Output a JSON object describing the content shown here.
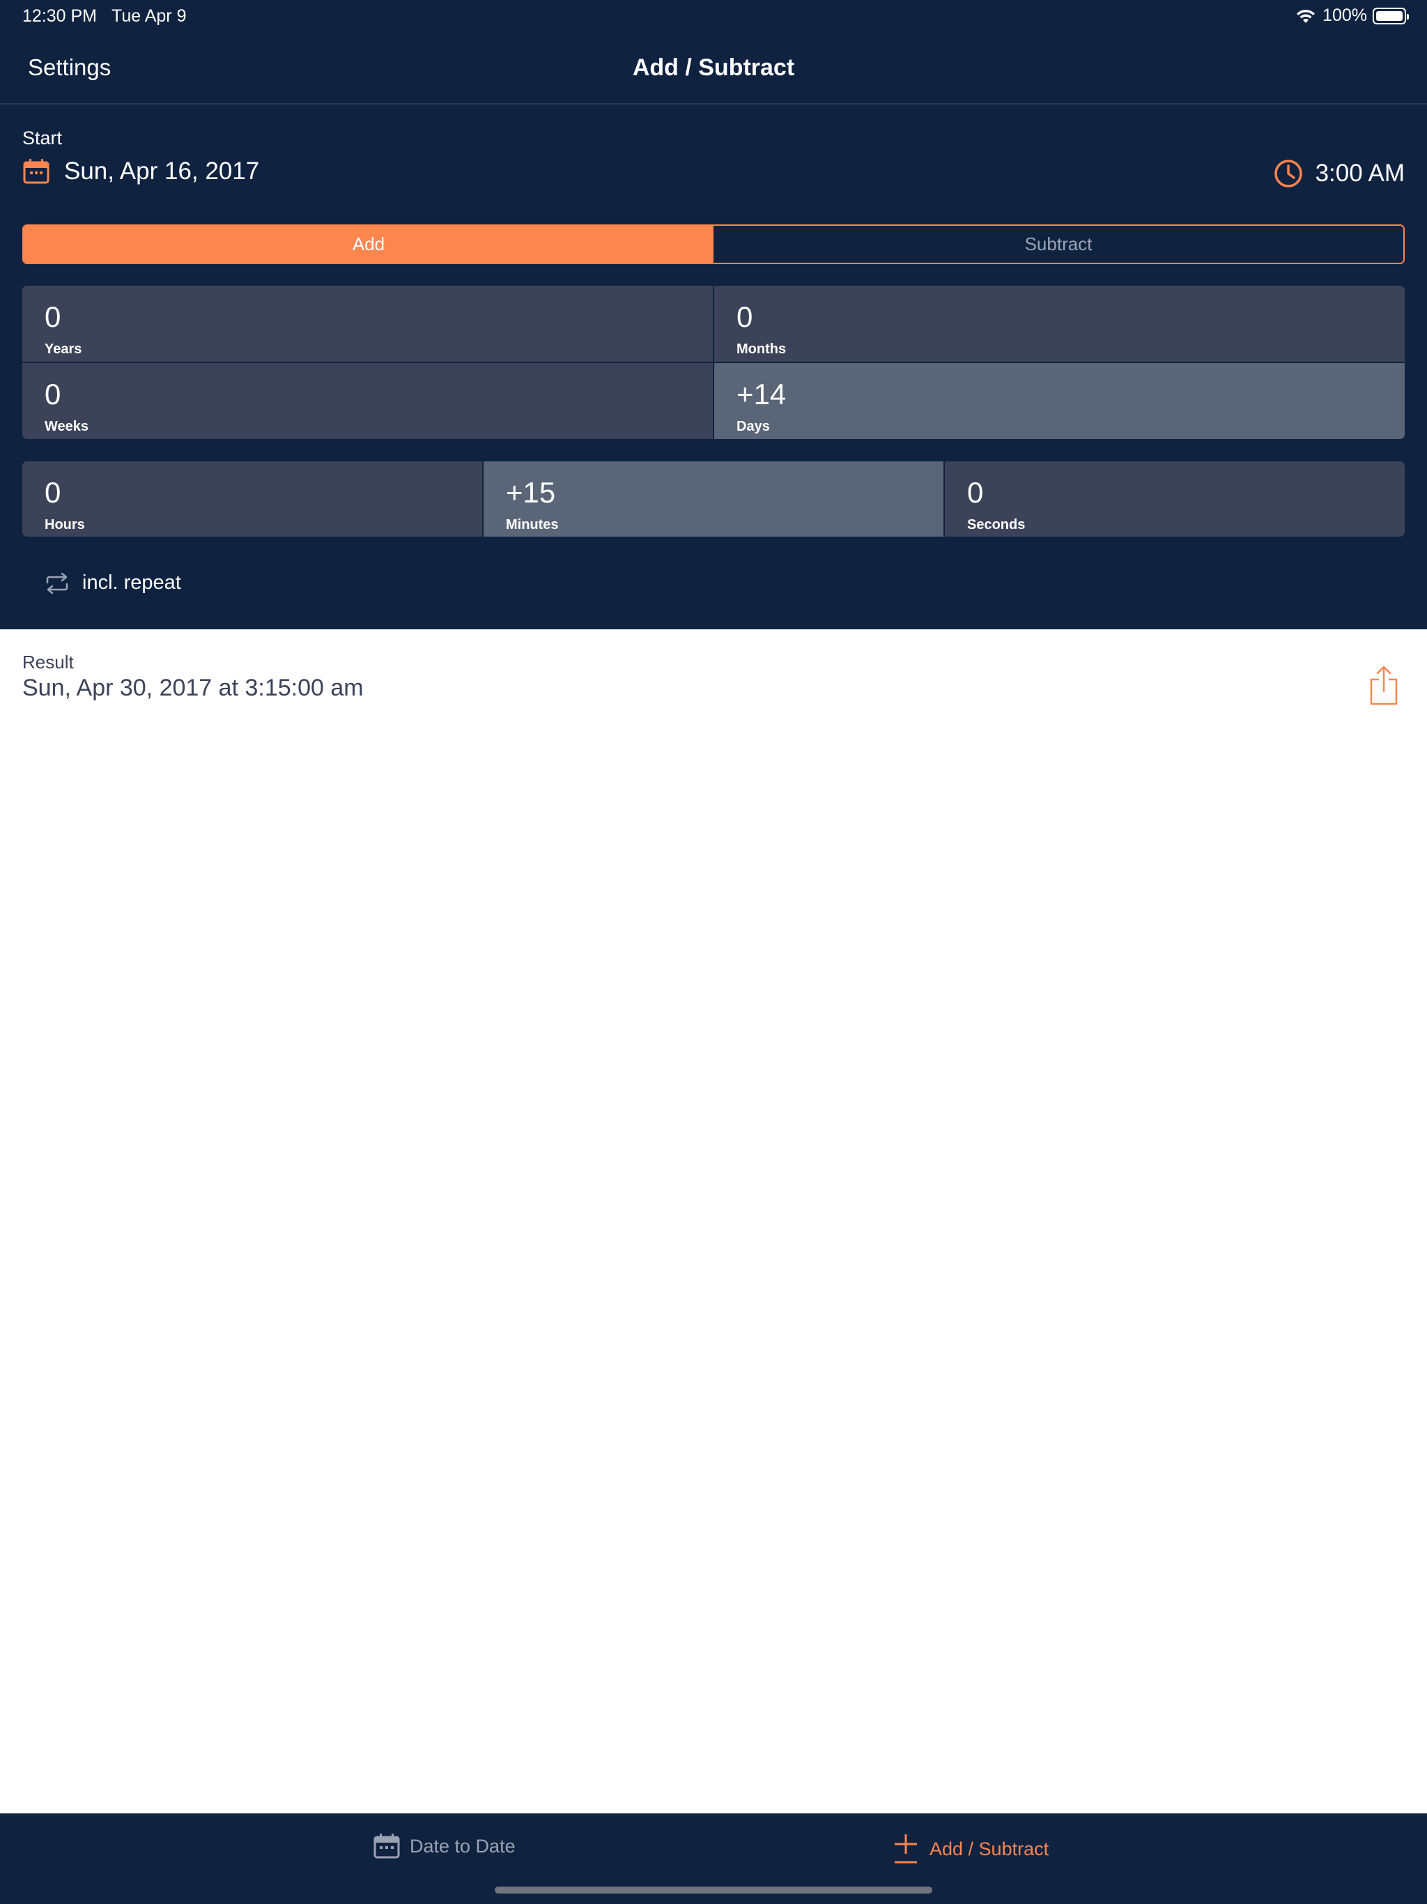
{
  "status_bar": {
    "time": "12:30 PM",
    "date": "Tue Apr 9",
    "battery": "100%"
  },
  "nav": {
    "left_label": "Settings",
    "title": "Add / Subtract"
  },
  "start": {
    "label": "Start",
    "date": "Sun, Apr 16, 2017",
    "time": "3:00 AM"
  },
  "mode": {
    "options": [
      "Add",
      "Subtract"
    ],
    "selected": "Add"
  },
  "units_top": [
    {
      "value": "0",
      "label": "Years"
    },
    {
      "value": "0",
      "label": "Months"
    },
    {
      "value": "0",
      "label": "Weeks"
    },
    {
      "value": "+14",
      "label": "Days"
    }
  ],
  "units_bottom": [
    {
      "value": "0",
      "label": "Hours"
    },
    {
      "value": "+15",
      "label": "Minutes"
    },
    {
      "value": "0",
      "label": "Seconds"
    }
  ],
  "repeat": {
    "label": "incl. repeat"
  },
  "result": {
    "label": "Result",
    "value": "Sun, Apr 30, 2017 at 3:15:00 am"
  },
  "tabs": [
    {
      "label": "Date to Date",
      "icon": "calendar-icon",
      "active": false
    },
    {
      "label": "Add / Subtract",
      "icon": "plus-minus-icon",
      "active": true
    }
  ],
  "colors": {
    "background_dark": "#0f2240",
    "accent": "#fc864e",
    "cell": "#3c4358",
    "cell_highlight": "#5a6577"
  }
}
